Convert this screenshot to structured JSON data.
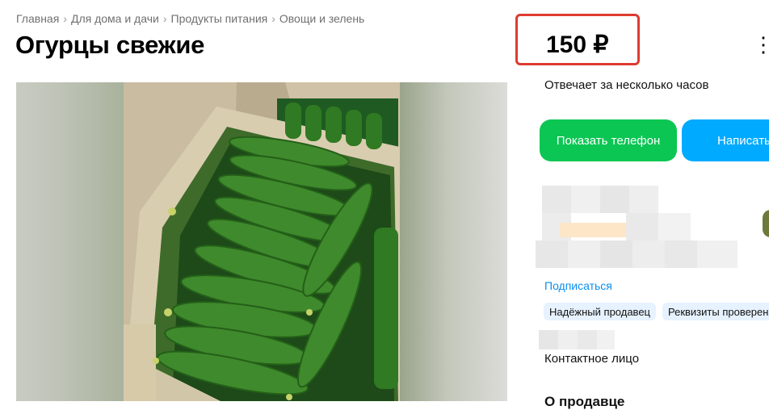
{
  "breadcrumbs": [
    "Главная",
    "Для дома и дачи",
    "Продукты питания",
    "Овощи и зелень"
  ],
  "breadcrumb_separator": "›",
  "title": "Огурцы свежие",
  "price": "150 ₽",
  "more_menu_glyph": "⋮",
  "seller": {
    "response_time": "Отвечает за несколько часов",
    "subscribe_label": "Подписаться",
    "badges": [
      "Надёжный продавец",
      "Реквизиты проверены"
    ],
    "contact_label": "Контактное лицо"
  },
  "buttons": {
    "show_phone": "Показать телефон",
    "write_message": "Написать"
  },
  "section_heading_cut": "О продавце",
  "colors": {
    "price_highlight": "#de3b2f",
    "phone_button": "#0bc653",
    "message_button": "#00aaff",
    "link": "#0a8ef0",
    "badge_bg": "#e6f2ff"
  },
  "icons": [
    "more-vertical-icon",
    "chevron-right-icon"
  ]
}
